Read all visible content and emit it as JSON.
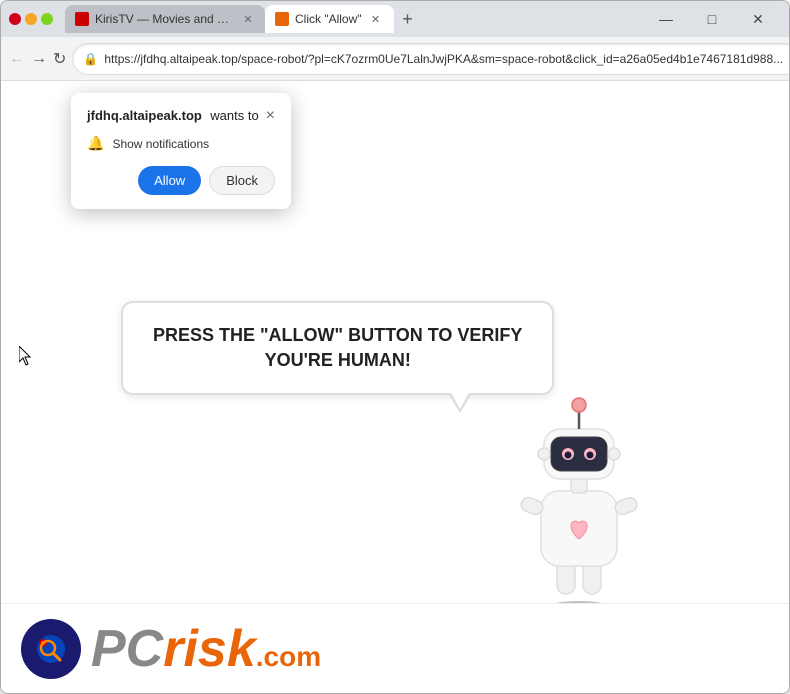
{
  "browser": {
    "title_bar_bg": "#dee1e6",
    "tabs": [
      {
        "id": "tab1",
        "label": "KirisTV — Movies and Series D...",
        "favicon_color": "#c00",
        "active": false
      },
      {
        "id": "tab2",
        "label": "Click \"Allow\"",
        "active": true
      }
    ],
    "new_tab_label": "+",
    "window_controls": {
      "minimize": "—",
      "maximize": "□",
      "close": "✕"
    }
  },
  "toolbar": {
    "back_title": "Back",
    "forward_title": "Forward",
    "reload_title": "Reload",
    "url": "https://jfdhq.altaipeak.top/space-robot/?pl=cK7ozrm0Ue7LalnJwjPKA&sm=space-robot&click_id=a26a05ed4b1e7467181d988...",
    "url_short": "https://jfdhq.altaipeak.top/space-robot/?pl=cK7ozrm0Ue7LalnJwjPKA&sm=space-robot&click_id=a26a05ed4b1e7467181d988..."
  },
  "notification_popup": {
    "domain": "jfdhq.altaipeak.top",
    "wants_text": "wants to",
    "show_notifications_label": "Show notifications",
    "allow_label": "Allow",
    "block_label": "Block",
    "close_label": "×"
  },
  "main_content": {
    "bubble_line1": "PRESS THE \"ALLOW\" BUTTON TO VERIFY",
    "bubble_line2": "YOU'RE HUMAN!"
  },
  "pcrisk": {
    "pc_text": "PC",
    "risk_text": "risk",
    "dot_com": ".com"
  },
  "icons": {
    "back": "←",
    "forward": "→",
    "reload": "↻",
    "lock": "🔒",
    "star": "☆",
    "download": "⬇",
    "profile": "👤",
    "menu": "⋮",
    "bell": "🔔"
  }
}
